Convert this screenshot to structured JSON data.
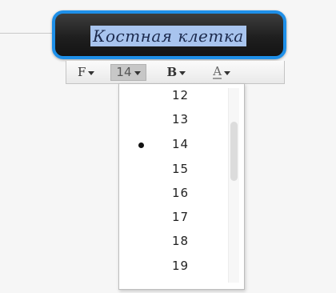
{
  "node": {
    "text": "Костная клетка"
  },
  "toolbar": {
    "font_label": "F",
    "size_label": "14",
    "bold_label": "B",
    "color_label": "A"
  },
  "font_size_menu": {
    "selected": "14",
    "options": [
      "12",
      "13",
      "14",
      "15",
      "16",
      "17",
      "18",
      "19"
    ]
  },
  "colors": {
    "node_border": "#1e8fe8",
    "node_fill": "#1f1f1f",
    "text_selection": "#a8c4ee"
  }
}
